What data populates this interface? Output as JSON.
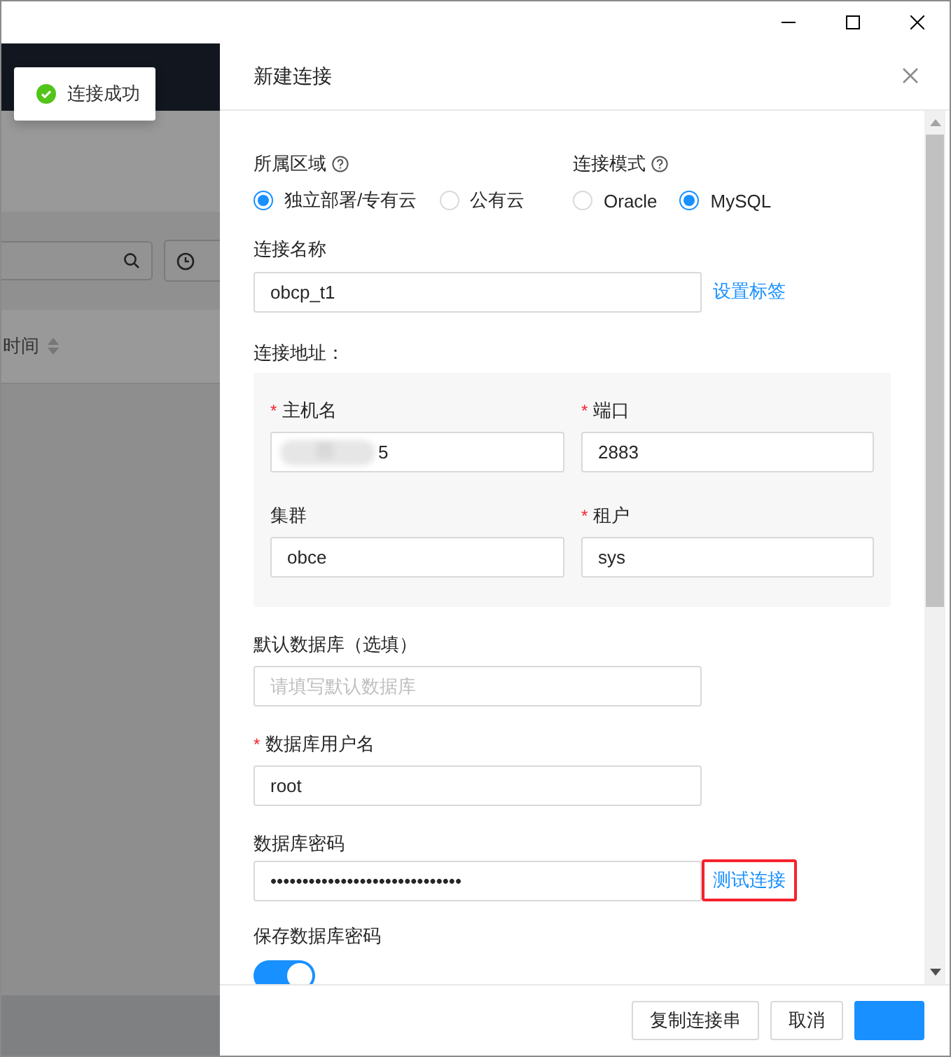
{
  "background": {
    "column_header": "时间"
  },
  "toast": {
    "message": "连接成功"
  },
  "drawer": {
    "title": "新建连接",
    "region": {
      "label": "所属区域",
      "options": [
        {
          "label": "独立部署/专有云",
          "selected": true
        },
        {
          "label": "公有云",
          "selected": false
        }
      ]
    },
    "mode": {
      "label": "连接模式",
      "options": [
        {
          "label": "Oracle",
          "selected": false
        },
        {
          "label": "MySQL",
          "selected": true
        }
      ]
    },
    "name": {
      "label": "连接名称",
      "value": "obcp_t1",
      "link": "设置标签"
    },
    "address": {
      "label": "连接地址：",
      "fields": [
        {
          "label": "主机名",
          "required_mark": "*",
          "value": "5",
          "kind": "redacted"
        },
        {
          "label": "端口",
          "required_mark": "*",
          "value": "2883",
          "kind": "text"
        },
        {
          "label": "集群",
          "value": "obce",
          "kind": "text"
        },
        {
          "label": "租户",
          "required_mark": "*",
          "value": "sys",
          "kind": "text"
        }
      ]
    },
    "default_db": {
      "label": "默认数据库（选填）",
      "placeholder": "请填写默认数据库"
    },
    "username": {
      "label": "数据库用户名",
      "required_mark": "*",
      "value": "root"
    },
    "password": {
      "label": "数据库密码",
      "value": "••••••••••••••••••••••••••••••",
      "link": "测试连接",
      "highlighted": true
    },
    "save_password": {
      "label": "保存数据库密码",
      "on": true
    },
    "buttons": [
      {
        "label": "复制连接串",
        "kind": "default"
      },
      {
        "label": "取消",
        "kind": "default"
      },
      {
        "kind": "primary"
      }
    ]
  }
}
